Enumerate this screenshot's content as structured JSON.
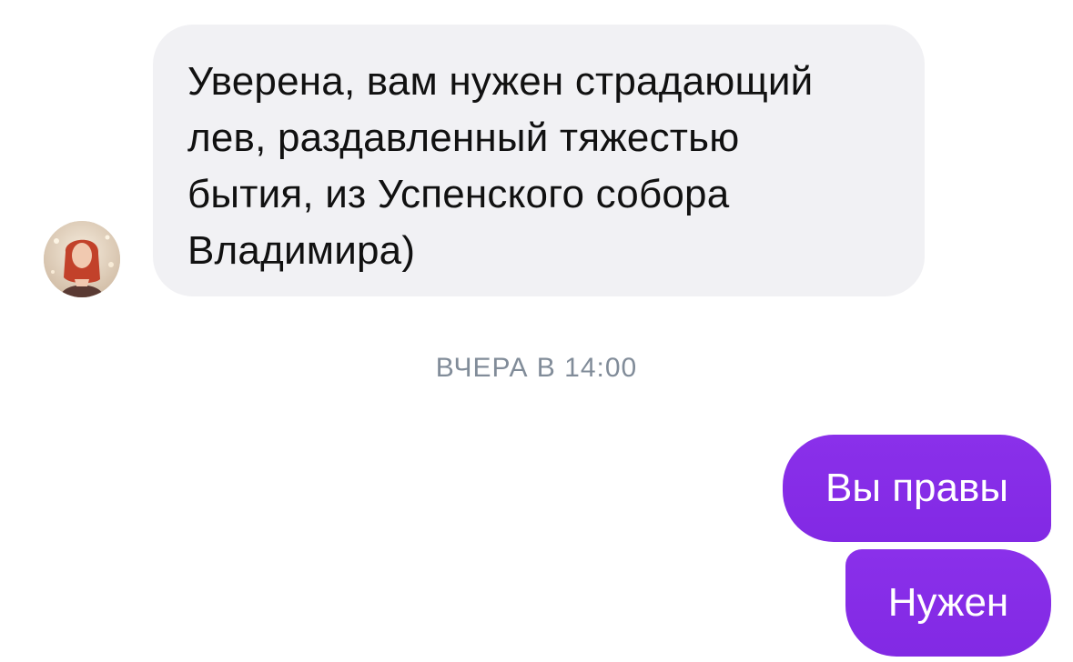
{
  "messages": {
    "incoming": {
      "text": "Уверена, вам нужен страдающий\nлев, раздавленный тяжестью\nбытия, из Успенского собора\nВладимира)"
    },
    "timestamp": "ВЧЕРА В 14:00",
    "outgoing": [
      {
        "text": "Вы правы"
      },
      {
        "text": "Нужен"
      }
    ]
  },
  "colors": {
    "incoming_bubble": "#f1f1f4",
    "outgoing_bubble": "#8a2be2",
    "timestamp_text": "#818c99",
    "message_text": "#111111"
  },
  "icons": {
    "avatar": "user-avatar-photo"
  }
}
